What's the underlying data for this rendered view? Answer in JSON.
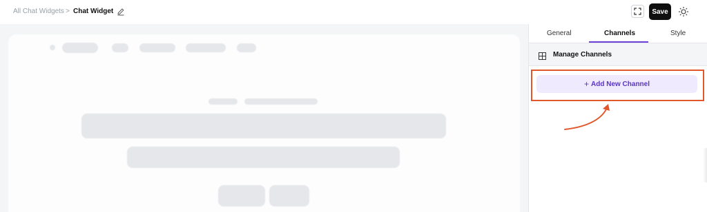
{
  "breadcrumb": {
    "parent": "All Chat Widgets",
    "separator": ">",
    "current": "Chat Widget"
  },
  "toolbar": {
    "save_label": "Save",
    "expand_icon": "expand-icon",
    "theme_icon": "sun-icon"
  },
  "panel": {
    "tabs": [
      {
        "label": "General",
        "active": false
      },
      {
        "label": "Channels",
        "active": true
      },
      {
        "label": "Style",
        "active": false
      }
    ],
    "section_title": "Manage Channels",
    "add_button_label": "Add New Channel",
    "add_button_prefix": "+"
  },
  "colors": {
    "accent": "#6b3fd6",
    "highlight": "#e2572a",
    "add_button_bg": "#efeafd",
    "save_bg": "#0f0f10"
  }
}
